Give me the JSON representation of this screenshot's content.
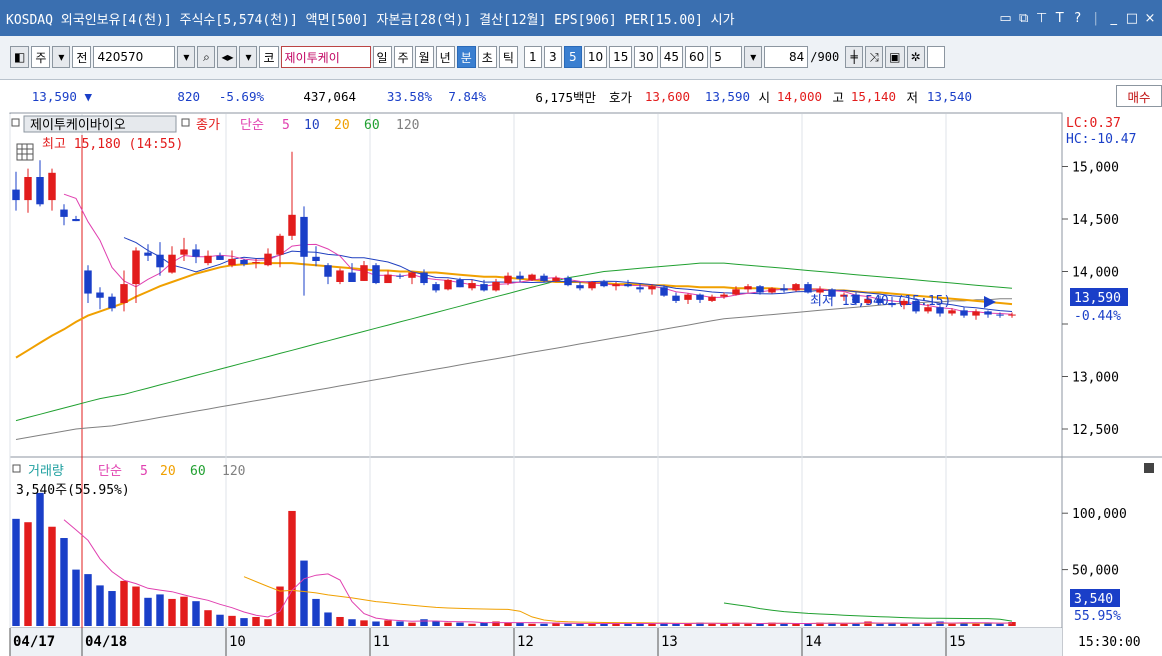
{
  "window": {
    "title": "KOSDAQ 외국인보유[4(천)] 주식수[5,574(천)] 액면[500] 자본금[28(억)] 결산[12월] EPS[906] PER[15.00] 시가",
    "icons": [
      "restore-icon",
      "popout-icon",
      "pin-icon",
      "font-icon",
      "help-icon",
      "minimize-icon",
      "maximize-icon",
      "close-icon"
    ],
    "icon_glyphs": [
      "▭",
      "⧉",
      "⊤",
      "T",
      "?",
      "_",
      "□",
      "×"
    ]
  },
  "toolbar": {
    "market_label": "주",
    "all_label": "전",
    "code": "420570",
    "code_label": "코",
    "stock_name": "제이투케이",
    "periods": [
      "일",
      "주",
      "월",
      "년",
      "분",
      "초",
      "틱"
    ],
    "selected_period": "분",
    "intervals": [
      "1",
      "3",
      "5",
      "10",
      "15",
      "30",
      "45",
      "60"
    ],
    "selected_interval": "5",
    "interval_value": "5",
    "count_value": "84",
    "count_total": "/900"
  },
  "quote": {
    "price": "13,590",
    "direction": "▼",
    "change": "820",
    "change_pct": "-5.69%",
    "volume": "437,064",
    "vol_ratio": "33.58%",
    "turnover": "7.84%",
    "amount": "6,175백만",
    "hoga_label": "호가",
    "ask": "13,600",
    "bid": "13,590",
    "open_label": "시",
    "open": "14,000",
    "high_label": "고",
    "high": "15,140",
    "low_label": "저",
    "low": "13,540",
    "buy_label": "매수"
  },
  "price_panel": {
    "name_label": "제이투케이바이오",
    "close_label": "종가",
    "ma_label": "단순",
    "ma_periods": [
      "5",
      "10",
      "20",
      "60",
      "120"
    ],
    "high_annot": "최고 15,180 (14:55)",
    "low_annot": "최저 13,540 (15:15)",
    "lc": "LC:0.37",
    "hc": "HC:-10.47",
    "yticks": [
      "15,000",
      "14,500",
      "14,000",
      "13,500",
      "13,000",
      "12,500"
    ],
    "current": "13,590",
    "current_pct": "-0.44%"
  },
  "volume_panel": {
    "title": "거래량",
    "ma_label": "단순",
    "ma_periods": [
      "5",
      "20",
      "60",
      "120"
    ],
    "current_annot": "3,540주(55.95%)",
    "yticks": [
      "100,000",
      "50,000"
    ],
    "current": "3,540",
    "current_pct": "55.95%"
  },
  "xaxis": {
    "labels": [
      "04/17",
      "04/18",
      "10",
      "11",
      "12",
      "13",
      "14",
      "15"
    ],
    "time": "15:30:00"
  },
  "colors": {
    "up": "#e21c1c",
    "down": "#1a3fc8",
    "ma5": "#e040b0",
    "ma10": "#2040c0",
    "ma20": "#f0a000",
    "ma60": "#20a030",
    "ma120": "#808080"
  },
  "chart_data": {
    "type": "candlestick",
    "title": "제이투케이바이오",
    "unit": "KRW",
    "ylim": [
      12300,
      15300
    ],
    "candles": [
      {
        "o": 14780,
        "h": 14950,
        "l": 14580,
        "c": 14680
      },
      {
        "o": 14680,
        "h": 14980,
        "l": 14560,
        "c": 14900
      },
      {
        "o": 14900,
        "h": 15060,
        "l": 14620,
        "c": 14640
      },
      {
        "o": 14680,
        "h": 14980,
        "l": 14580,
        "c": 14940
      },
      {
        "o": 14590,
        "h": 14640,
        "l": 14440,
        "c": 14520
      },
      {
        "o": 14500,
        "h": 14530,
        "l": 14480,
        "c": 14480
      },
      {
        "o": 14010,
        "h": 14060,
        "l": 13700,
        "c": 13790
      },
      {
        "o": 13800,
        "h": 13850,
        "l": 13640,
        "c": 13750
      },
      {
        "o": 13760,
        "h": 13790,
        "l": 13620,
        "c": 13650
      },
      {
        "o": 13700,
        "h": 14010,
        "l": 13620,
        "c": 13880
      },
      {
        "o": 13880,
        "h": 14230,
        "l": 13700,
        "c": 14200
      },
      {
        "o": 14180,
        "h": 14260,
        "l": 14100,
        "c": 14150
      },
      {
        "o": 14160,
        "h": 14280,
        "l": 13960,
        "c": 14040
      },
      {
        "o": 13990,
        "h": 14240,
        "l": 13980,
        "c": 14160
      },
      {
        "o": 14160,
        "h": 14320,
        "l": 14100,
        "c": 14210
      },
      {
        "o": 14210,
        "h": 14260,
        "l": 14080,
        "c": 14140
      },
      {
        "o": 14080,
        "h": 14200,
        "l": 14060,
        "c": 14150
      },
      {
        "o": 14150,
        "h": 14180,
        "l": 14110,
        "c": 14110
      },
      {
        "o": 14060,
        "h": 14200,
        "l": 14040,
        "c": 14120
      },
      {
        "o": 14110,
        "h": 14120,
        "l": 14050,
        "c": 14070
      },
      {
        "o": 14080,
        "h": 14120,
        "l": 14030,
        "c": 14090
      },
      {
        "o": 14060,
        "h": 14220,
        "l": 14050,
        "c": 14170
      },
      {
        "o": 14160,
        "h": 14360,
        "l": 14040,
        "c": 14340
      },
      {
        "o": 14340,
        "h": 15140,
        "l": 14300,
        "c": 14540
      },
      {
        "o": 14520,
        "h": 14620,
        "l": 13770,
        "c": 14140
      },
      {
        "o": 14140,
        "h": 14240,
        "l": 14050,
        "c": 14100
      },
      {
        "o": 14060,
        "h": 14080,
        "l": 13880,
        "c": 13950
      },
      {
        "o": 13900,
        "h": 14030,
        "l": 13880,
        "c": 14010
      },
      {
        "o": 13990,
        "h": 14080,
        "l": 13900,
        "c": 13900
      },
      {
        "o": 13910,
        "h": 14100,
        "l": 13910,
        "c": 14060
      },
      {
        "o": 14060,
        "h": 14080,
        "l": 13880,
        "c": 13890
      },
      {
        "o": 13890,
        "h": 14010,
        "l": 13890,
        "c": 13970
      },
      {
        "o": 13960,
        "h": 13980,
        "l": 13930,
        "c": 13950
      },
      {
        "o": 13940,
        "h": 14000,
        "l": 13880,
        "c": 13990
      },
      {
        "o": 13990,
        "h": 14020,
        "l": 13870,
        "c": 13890
      },
      {
        "o": 13880,
        "h": 13900,
        "l": 13800,
        "c": 13820
      },
      {
        "o": 13830,
        "h": 13930,
        "l": 13820,
        "c": 13920
      },
      {
        "o": 13920,
        "h": 13940,
        "l": 13850,
        "c": 13850
      },
      {
        "o": 13840,
        "h": 13920,
        "l": 13820,
        "c": 13890
      },
      {
        "o": 13880,
        "h": 13920,
        "l": 13810,
        "c": 13820
      },
      {
        "o": 13820,
        "h": 13930,
        "l": 13810,
        "c": 13900
      },
      {
        "o": 13890,
        "h": 13990,
        "l": 13870,
        "c": 13960
      },
      {
        "o": 13960,
        "h": 14000,
        "l": 13900,
        "c": 13930
      },
      {
        "o": 13920,
        "h": 13980,
        "l": 13910,
        "c": 13970
      },
      {
        "o": 13960,
        "h": 13980,
        "l": 13900,
        "c": 13910
      },
      {
        "o": 13910,
        "h": 13960,
        "l": 13900,
        "c": 13940
      },
      {
        "o": 13940,
        "h": 13960,
        "l": 13860,
        "c": 13870
      },
      {
        "o": 13870,
        "h": 13900,
        "l": 13820,
        "c": 13840
      },
      {
        "o": 13840,
        "h": 13910,
        "l": 13820,
        "c": 13900
      },
      {
        "o": 13900,
        "h": 13920,
        "l": 13850,
        "c": 13860
      },
      {
        "o": 13860,
        "h": 13900,
        "l": 13820,
        "c": 13880
      },
      {
        "o": 13880,
        "h": 13920,
        "l": 13850,
        "c": 13860
      },
      {
        "o": 13850,
        "h": 13880,
        "l": 13800,
        "c": 13830
      },
      {
        "o": 13830,
        "h": 13880,
        "l": 13780,
        "c": 13860
      },
      {
        "o": 13850,
        "h": 13870,
        "l": 13760,
        "c": 13770
      },
      {
        "o": 13770,
        "h": 13800,
        "l": 13700,
        "c": 13720
      },
      {
        "o": 13730,
        "h": 13790,
        "l": 13690,
        "c": 13780
      },
      {
        "o": 13780,
        "h": 13790,
        "l": 13700,
        "c": 13730
      },
      {
        "o": 13720,
        "h": 13780,
        "l": 13710,
        "c": 13760
      },
      {
        "o": 13760,
        "h": 13800,
        "l": 13740,
        "c": 13780
      },
      {
        "o": 13780,
        "h": 13860,
        "l": 13770,
        "c": 13830
      },
      {
        "o": 13830,
        "h": 13880,
        "l": 13800,
        "c": 13860
      },
      {
        "o": 13860,
        "h": 13870,
        "l": 13780,
        "c": 13800
      },
      {
        "o": 13800,
        "h": 13850,
        "l": 13790,
        "c": 13840
      },
      {
        "o": 13840,
        "h": 13880,
        "l": 13800,
        "c": 13820
      },
      {
        "o": 13820,
        "h": 13890,
        "l": 13810,
        "c": 13880
      },
      {
        "o": 13880,
        "h": 13900,
        "l": 13790,
        "c": 13800
      },
      {
        "o": 13800,
        "h": 13860,
        "l": 13780,
        "c": 13830
      },
      {
        "o": 13830,
        "h": 13840,
        "l": 13750,
        "c": 13760
      },
      {
        "o": 13760,
        "h": 13800,
        "l": 13720,
        "c": 13780
      },
      {
        "o": 13780,
        "h": 13800,
        "l": 13680,
        "c": 13700
      },
      {
        "o": 13700,
        "h": 13760,
        "l": 13680,
        "c": 13740
      },
      {
        "o": 13740,
        "h": 13770,
        "l": 13680,
        "c": 13700
      },
      {
        "o": 13700,
        "h": 13760,
        "l": 13660,
        "c": 13680
      },
      {
        "o": 13680,
        "h": 13740,
        "l": 13640,
        "c": 13720
      },
      {
        "o": 13720,
        "h": 13730,
        "l": 13600,
        "c": 13620
      },
      {
        "o": 13620,
        "h": 13690,
        "l": 13600,
        "c": 13660
      },
      {
        "o": 13660,
        "h": 13680,
        "l": 13570,
        "c": 13600
      },
      {
        "o": 13600,
        "h": 13650,
        "l": 13580,
        "c": 13630
      },
      {
        "o": 13630,
        "h": 13660,
        "l": 13560,
        "c": 13580
      },
      {
        "o": 13580,
        "h": 13640,
        "l": 13540,
        "c": 13620
      },
      {
        "o": 13620,
        "h": 13630,
        "l": 13560,
        "c": 13590
      },
      {
        "o": 13590,
        "h": 13610,
        "l": 13560,
        "c": 13580
      },
      {
        "o": 13580,
        "h": 13610,
        "l": 13560,
        "c": 13590
      }
    ],
    "volumes": [
      95000,
      92000,
      118000,
      88000,
      78000,
      50000,
      46000,
      36000,
      31000,
      40000,
      35000,
      25000,
      28000,
      24000,
      26000,
      22000,
      14000,
      10000,
      9000,
      7000,
      8000,
      6000,
      35000,
      102000,
      58000,
      24000,
      12000,
      8000,
      6000,
      5000,
      4000,
      5000,
      4000,
      3000,
      6000,
      4000,
      3000,
      3000,
      2000,
      3000,
      4000,
      3000,
      3000,
      2000,
      2000,
      3000,
      2000,
      2000,
      2000,
      2000,
      3000,
      2000,
      2000,
      2000,
      3000,
      2000,
      2000,
      3000,
      2000,
      2000,
      3000,
      2000,
      2000,
      3000,
      2000,
      2000,
      2000,
      3000,
      3000,
      2000,
      2000,
      4000,
      2000,
      3000,
      2000,
      2000,
      3000,
      4000,
      2000,
      3000,
      2000,
      3000,
      2000,
      3540
    ],
    "ma20": [
      13180,
      13250,
      13320,
      13390,
      13450,
      13520,
      13580,
      13620,
      13660,
      13700,
      13760,
      13810,
      13860,
      13900,
      13940,
      13980,
      14010,
      14040,
      14060,
      14070,
      14080,
      14080,
      14080,
      14080,
      14070,
      14060,
      14050,
      14040,
      14030,
      14020,
      14010,
      14010,
      14000,
      14000,
      13990,
      13990,
      13980,
      13970,
      13960,
      13950,
      13950,
      13940,
      13930,
      13920,
      13910,
      13900,
      13900,
      13900,
      13890,
      13890,
      13880,
      13880,
      13880,
      13870,
      13870,
      13860,
      13860,
      13850,
      13850,
      13850,
      13840,
      13840,
      13840,
      13840,
      13830,
      13830,
      13830,
      13830,
      13820,
      13820,
      13810,
      13800,
      13800,
      13790,
      13780,
      13770,
      13760,
      13750,
      13740,
      13730,
      13720,
      13710,
      13700,
      13690
    ],
    "ma60": [
      12580,
      12610,
      12640,
      12670,
      12700,
      12730,
      12760,
      12790,
      12810,
      12830,
      12860,
      12890,
      12920,
      12950,
      12980,
      13010,
      13040,
      13070,
      13100,
      13130,
      13160,
      13190,
      13220,
      13250,
      13280,
      13310,
      13340,
      13370,
      13400,
      13430,
      13460,
      13490,
      13520,
      13550,
      13580,
      13610,
      13640,
      13670,
      13700,
      13730,
      13760,
      13790,
      13820,
      13850,
      13880,
      13910,
      13940,
      13960,
      13980,
      14000,
      14010,
      14020,
      14030,
      14040,
      14050,
      14060,
      14070,
      14080,
      14080,
      14080,
      14070,
      14060,
      14050,
      14040,
      14030,
      14020,
      14010,
      14000,
      13990,
      13980,
      13970,
      13960,
      13950,
      13940,
      13930,
      13920,
      13910,
      13900,
      13890,
      13880,
      13870,
      13860,
      13850,
      13840
    ],
    "ma120": [
      12400,
      12420,
      12440,
      12460,
      12480,
      12500,
      12510,
      12520,
      12530,
      12550,
      12570,
      12590,
      12610,
      12630,
      12650,
      12670,
      12690,
      12710,
      12730,
      12750,
      12770,
      12790,
      12810,
      12830,
      12850,
      12870,
      12890,
      12910,
      12930,
      12950,
      12970,
      12990,
      13010,
      13030,
      13050,
      13070,
      13090,
      13110,
      13130,
      13150,
      13170,
      13190,
      13210,
      13230,
      13250,
      13270,
      13290,
      13310,
      13330,
      13350,
      13370,
      13390,
      13410,
      13430,
      13450,
      13470,
      13490,
      13510,
      13530,
      13550,
      13560,
      13570,
      13580,
      13590,
      13600,
      13610,
      13620,
      13630,
      13640,
      13650,
      13660,
      13670,
      13680,
      13690,
      13700,
      13700,
      13710,
      13710,
      13720,
      13720,
      13730,
      13730,
      13740,
      13740
    ]
  }
}
